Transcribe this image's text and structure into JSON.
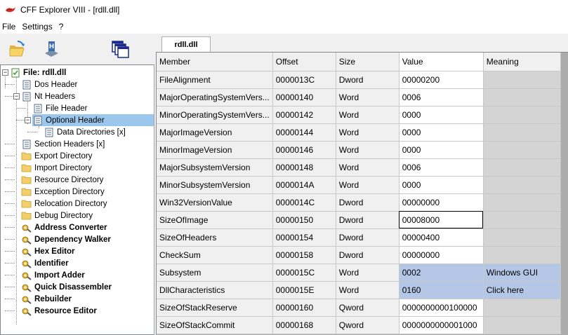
{
  "window": {
    "title": "CFF Explorer VIII - [rdll.dll]"
  },
  "menu": [
    "File",
    "Settings",
    "?"
  ],
  "tab": {
    "label": "rdll.dll"
  },
  "tree": [
    {
      "label": "File: rdll.dll",
      "level": 0,
      "icon": "pe-file-icon",
      "bold": true,
      "expander": "minus"
    },
    {
      "label": "Dos Header",
      "level": 1,
      "icon": "header-doc-icon"
    },
    {
      "label": "Nt Headers",
      "level": 1,
      "icon": "header-doc-icon",
      "expander": "minus"
    },
    {
      "label": "File Header",
      "level": 2,
      "icon": "header-doc-icon"
    },
    {
      "label": "Optional Header",
      "level": 2,
      "icon": "header-doc-icon",
      "expander": "minus",
      "selected": true
    },
    {
      "label": "Data Directories [x]",
      "level": 3,
      "icon": "header-doc-icon"
    },
    {
      "label": "Section Headers [x]",
      "level": 1,
      "icon": "header-doc-icon"
    },
    {
      "label": "Export Directory",
      "level": 1,
      "icon": "folder-icon"
    },
    {
      "label": "Import Directory",
      "level": 1,
      "icon": "folder-icon"
    },
    {
      "label": "Resource Directory",
      "level": 1,
      "icon": "folder-icon"
    },
    {
      "label": "Exception Directory",
      "level": 1,
      "icon": "folder-icon"
    },
    {
      "label": "Relocation Directory",
      "level": 1,
      "icon": "folder-icon"
    },
    {
      "label": "Debug Directory",
      "level": 1,
      "icon": "folder-icon"
    },
    {
      "label": "Address Converter",
      "level": 1,
      "icon": "tool-gear-icon",
      "bold": true
    },
    {
      "label": "Dependency Walker",
      "level": 1,
      "icon": "tool-gear-icon",
      "bold": true
    },
    {
      "label": "Hex Editor",
      "level": 1,
      "icon": "tool-gear-icon",
      "bold": true
    },
    {
      "label": "Identifier",
      "level": 1,
      "icon": "tool-gear-icon",
      "bold": true
    },
    {
      "label": "Import Adder",
      "level": 1,
      "icon": "tool-gear-icon",
      "bold": true
    },
    {
      "label": "Quick Disassembler",
      "level": 1,
      "icon": "tool-gear-icon",
      "bold": true
    },
    {
      "label": "Rebuilder",
      "level": 1,
      "icon": "tool-gear-icon",
      "bold": true
    },
    {
      "label": "Resource Editor",
      "level": 1,
      "icon": "tool-gear-icon",
      "bold": true
    }
  ],
  "columns": [
    "Member",
    "Offset",
    "Size",
    "Value",
    "Meaning"
  ],
  "rows": [
    {
      "member": "FileAlignment",
      "offset": "0000013C",
      "size": "Dword",
      "value": "00000200",
      "meaning": ""
    },
    {
      "member": "MajorOperatingSystemVers...",
      "offset": "00000140",
      "size": "Word",
      "value": "0006",
      "meaning": ""
    },
    {
      "member": "MinorOperatingSystemVers...",
      "offset": "00000142",
      "size": "Word",
      "value": "0000",
      "meaning": ""
    },
    {
      "member": "MajorImageVersion",
      "offset": "00000144",
      "size": "Word",
      "value": "0000",
      "meaning": ""
    },
    {
      "member": "MinorImageVersion",
      "offset": "00000146",
      "size": "Word",
      "value": "0000",
      "meaning": ""
    },
    {
      "member": "MajorSubsystemVersion",
      "offset": "00000148",
      "size": "Word",
      "value": "0006",
      "meaning": ""
    },
    {
      "member": "MinorSubsystemVersion",
      "offset": "0000014A",
      "size": "Word",
      "value": "0000",
      "meaning": ""
    },
    {
      "member": "Win32VersionValue",
      "offset": "0000014C",
      "size": "Dword",
      "value": "00000000",
      "meaning": ""
    },
    {
      "member": "SizeOfImage",
      "offset": "00000150",
      "size": "Dword",
      "value": "00008000",
      "meaning": "",
      "focus": true
    },
    {
      "member": "SizeOfHeaders",
      "offset": "00000154",
      "size": "Dword",
      "value": "00000400",
      "meaning": ""
    },
    {
      "member": "CheckSum",
      "offset": "00000158",
      "size": "Dword",
      "value": "00000000",
      "meaning": ""
    },
    {
      "member": "Subsystem",
      "offset": "0000015C",
      "size": "Word",
      "value": "0002",
      "meaning": "Windows GUI",
      "selected": true
    },
    {
      "member": "DllCharacteristics",
      "offset": "0000015E",
      "size": "Word",
      "value": "0160",
      "meaning": "Click here",
      "selected": true
    },
    {
      "member": "SizeOfStackReserve",
      "offset": "00000160",
      "size": "Qword",
      "value": "0000000000100000",
      "meaning": ""
    },
    {
      "member": "SizeOfStackCommit",
      "offset": "00000168",
      "size": "Qword",
      "value": "0000000000001000",
      "meaning": ""
    }
  ],
  "colors": {
    "selection": "#9cc7ec",
    "grid_selection": "#b4c7e7",
    "meaning_bg": "#d4d4d4"
  }
}
